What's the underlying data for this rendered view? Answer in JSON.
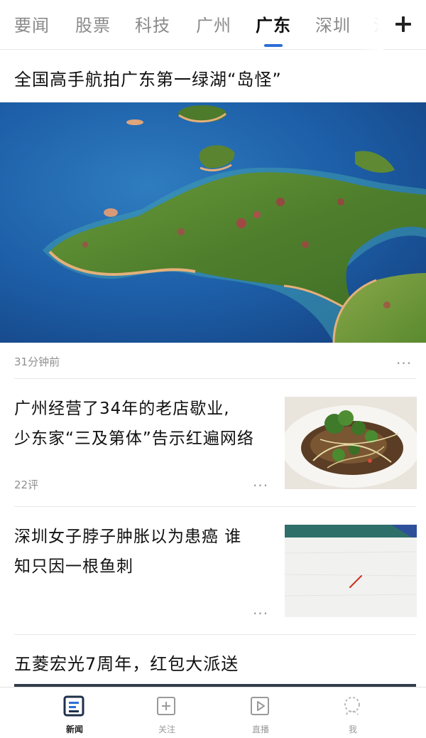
{
  "header": {
    "tabs": [
      {
        "label": "要闻",
        "active": false
      },
      {
        "label": "股票",
        "active": false
      },
      {
        "label": "科技",
        "active": false
      },
      {
        "label": "广州",
        "active": false
      },
      {
        "label": "广东",
        "active": true
      },
      {
        "label": "深圳",
        "active": false
      },
      {
        "label": "江",
        "active": false
      }
    ],
    "add_icon": "plus-icon",
    "accent_color": "#2f6fd6"
  },
  "feed": {
    "items": [
      {
        "title": "全国高手航拍广东第一绿湖“岛怪”",
        "meta": "31分钟前",
        "more": "···",
        "image": "aerial-lake-islands"
      },
      {
        "title_lines": [
          "广州经营了34年的老店歇业,",
          "少东家“三及第体”告示红遍网络"
        ],
        "meta": "22评",
        "more": "···",
        "image": "fish-dish-thumbnail"
      },
      {
        "title_lines": [
          "深圳女子脖子肿胀以为患癌 谁",
          "知只因一根鱼刺"
        ],
        "meta": "",
        "more": "···",
        "image": "fishbone-on-cloth-thumbnail"
      },
      {
        "title": "五菱宏光7周年，红包大派送"
      }
    ]
  },
  "bottom_nav": {
    "items": [
      {
        "label": "新闻",
        "icon": "news-icon",
        "active": true
      },
      {
        "label": "关注",
        "icon": "follow-icon",
        "active": false
      },
      {
        "label": "直播",
        "icon": "live-play-icon",
        "active": false
      },
      {
        "label": "我",
        "icon": "profile-icon",
        "active": false
      }
    ]
  }
}
